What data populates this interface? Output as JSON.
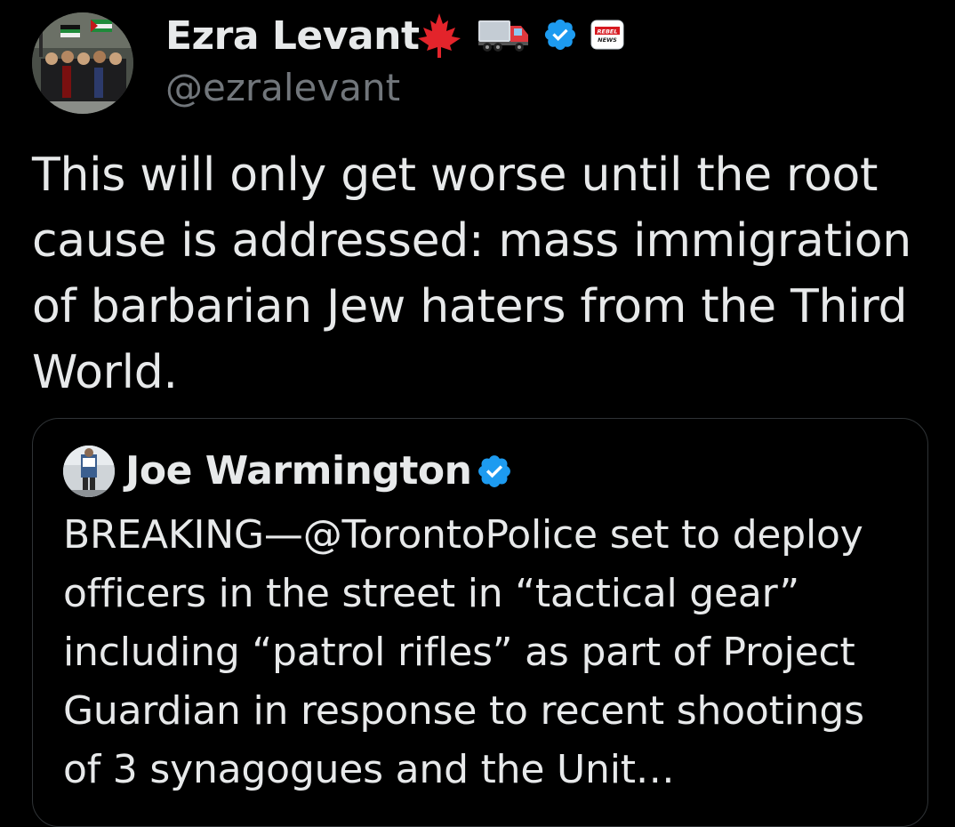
{
  "tweet": {
    "author": {
      "name": "Ezra Levant",
      "handle": "@ezralevant",
      "name_emojis": [
        "maple-leaf-icon",
        "truck-icon"
      ],
      "verified": true,
      "affiliate_badge_text": "REBEL NEWS"
    },
    "text": "This will only get worse until the root cause is addressed: mass immigration of barbarian Jew haters from the Third World.",
    "quoted_tweet": {
      "author": {
        "name": "Joe Warmington",
        "verified": true
      },
      "text": "BREAKING—@TorontoPolice set to deploy officers in the street in “tactical gear” including “patrol rifles” as part of Project Guardian in response to recent shootings of 3 synagogues and the Unit…"
    }
  },
  "colors": {
    "background": "#000000",
    "primary_text": "#e7e9ea",
    "secondary_text": "#71767b",
    "verified_blue": "#1d9bf0",
    "card_border": "#2f3336"
  }
}
